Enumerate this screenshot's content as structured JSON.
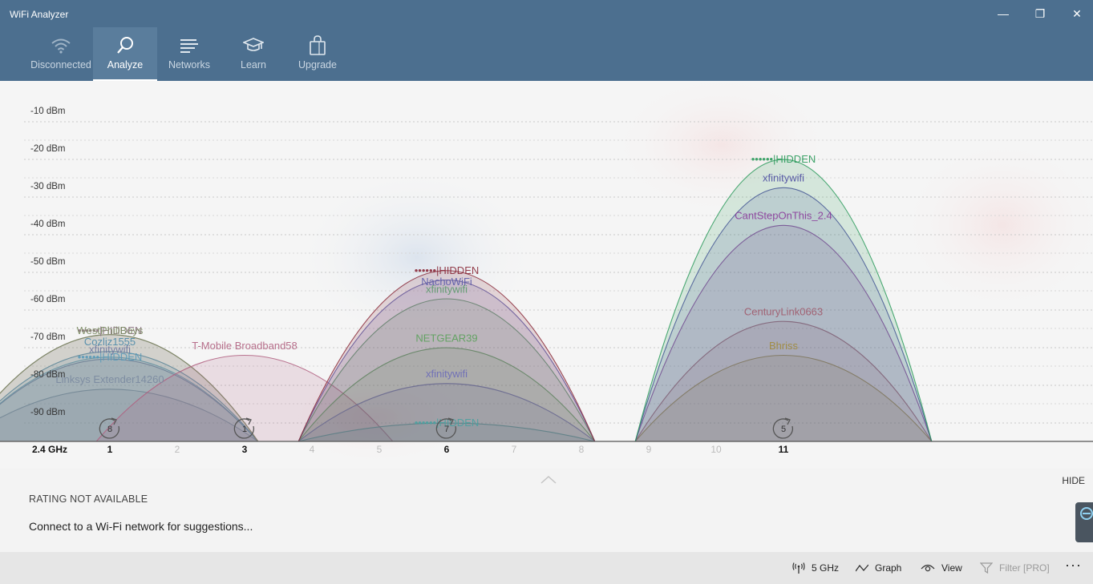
{
  "window": {
    "title": "WiFi Analyzer",
    "controls": {
      "minimize": "—",
      "maximize": "❐",
      "close": "✕"
    }
  },
  "nav": {
    "items": [
      {
        "label": "Disconnected",
        "icon": "wifi-icon",
        "active": false
      },
      {
        "label": "Analyze",
        "icon": "magnifier-icon",
        "active": true
      },
      {
        "label": "Networks",
        "icon": "list-icon",
        "active": false
      },
      {
        "label": "Learn",
        "icon": "graduation-cap-icon",
        "active": false
      },
      {
        "label": "Upgrade",
        "icon": "shopping-bag-icon",
        "active": false
      }
    ]
  },
  "chart_data": {
    "type": "area",
    "band_label": "2.4 GHz",
    "y_ticks": [
      "-10 dBm",
      "-20 dBm",
      "-30 dBm",
      "-40 dBm",
      "-50 dBm",
      "-60 dBm",
      "-70 dBm",
      "-80 dBm",
      "-90 dBm"
    ],
    "y_values": [
      -10,
      -20,
      -30,
      -40,
      -50,
      -60,
      -70,
      -80,
      -90
    ],
    "ylim": [
      -100,
      -5
    ],
    "x_ticks": [
      {
        "label": "1",
        "channel": 1,
        "bold": true
      },
      {
        "label": "2",
        "channel": 2,
        "bold": false
      },
      {
        "label": "3",
        "channel": 3,
        "bold": true
      },
      {
        "label": "4",
        "channel": 4,
        "bold": false
      },
      {
        "label": "5",
        "channel": 5,
        "bold": false
      },
      {
        "label": "6",
        "channel": 6,
        "bold": true
      },
      {
        "label": "7",
        "channel": 7,
        "bold": false
      },
      {
        "label": "8",
        "channel": 8,
        "bold": false
      },
      {
        "label": "9",
        "channel": 9,
        "bold": false
      },
      {
        "label": "10",
        "channel": 10,
        "bold": false
      },
      {
        "label": "11",
        "channel": 11,
        "bold": true
      }
    ],
    "xlim": [
      -1,
      13
    ],
    "grid": true,
    "networks": [
      {
        "name": "Linksys Extender14260",
        "channel": 1,
        "dbm": -84,
        "color": "#7a8aa0"
      },
      {
        "name": "xfinitywifi",
        "channel": 1,
        "dbm": -76,
        "color": "#6a76a0"
      },
      {
        "name": "••••••|HIDDEN",
        "channel": 1,
        "dbm": -75.5,
        "color": "#5a9ab8"
      },
      {
        "name": "Cozliz1555",
        "channel": 1,
        "dbm": -74,
        "color": "#4a88a8"
      },
      {
        "name": "••••••|HIDDEN",
        "channel": 1,
        "dbm": -69.5,
        "color": "#8a7080"
      },
      {
        "name": "WestPhillBoys",
        "channel": 1,
        "dbm": -69.5,
        "color": "#7a8a60"
      },
      {
        "name": "T-Mobile Broadband58",
        "channel": 3,
        "dbm": -75,
        "color": "#b06080"
      },
      {
        "name": "••••••|HIDDEN",
        "channel": 6,
        "dbm": -93,
        "color": "#4aa0a0"
      },
      {
        "name": "xfinitywifi",
        "channel": 6,
        "dbm": -82.5,
        "color": "#6a6ab8"
      },
      {
        "name": "NETGEAR39",
        "channel": 6,
        "dbm": -73,
        "color": "#5aa05a"
      },
      {
        "name": "xfinitywifi",
        "channel": 6,
        "dbm": -60,
        "color": "#5a9a6a"
      },
      {
        "name": "NachoWiFi",
        "channel": 6,
        "dbm": -55,
        "color": "#5a5aa8"
      },
      {
        "name": "••••••|HIDDEN",
        "channel": 6,
        "dbm": -52.5,
        "color": "#8a2a3a"
      },
      {
        "name": "Bhriss",
        "channel": 11,
        "dbm": -75,
        "color": "#a08a3a"
      },
      {
        "name": "CenturyLink0663",
        "channel": 11,
        "dbm": -66,
        "color": "#a05a6a"
      },
      {
        "name": "CantStepOnThis_2.4",
        "channel": 11,
        "dbm": -40.5,
        "color": "#8a3a9a"
      },
      {
        "name": "xfinitywifi",
        "channel": 11,
        "dbm": -30.5,
        "color": "#4a4aa0"
      },
      {
        "name": "••••••|HIDDEN",
        "channel": 11,
        "dbm": -23,
        "color": "#2a9a5a"
      }
    ],
    "label_offsets_dbm": [
      2.5,
      2.5,
      0,
      2.5,
      1,
      1,
      2.5,
      0,
      2.5,
      2.5,
      2.5,
      -0.5,
      0,
      2.5,
      2.5,
      2.5,
      2.5,
      0
    ],
    "channel_badges": [
      {
        "channel": 1,
        "count": "8"
      },
      {
        "channel": 3,
        "count": "1"
      },
      {
        "channel": 6,
        "count": "7"
      },
      {
        "channel": 11,
        "count": "5"
      }
    ]
  },
  "rating": {
    "title": "RATING NOT AVAILABLE",
    "suggestion": "Connect to a Wi-Fi network for suggestions...",
    "hide_label": "HIDE"
  },
  "commands": {
    "band": "5 GHz",
    "graph": "Graph",
    "view": "View",
    "filter": "Filter [PRO]",
    "more": "···"
  },
  "colors": {
    "titlebar": "#4c6f8f",
    "nav_active": "#5a7d9c"
  }
}
